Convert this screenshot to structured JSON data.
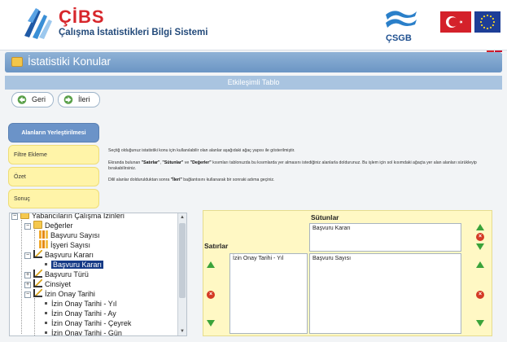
{
  "header": {
    "app_name": "ÇİBS",
    "app_subtitle": "Çalışma İstatistikleri Bilgi Sistemi",
    "ministry_abbr": "ÇSGB"
  },
  "page": {
    "title": "İstatistiki Konular",
    "subtitle": "Etkileşimli Tablo"
  },
  "nav": {
    "back_label": "Geri",
    "next_label": "İleri"
  },
  "steps": [
    {
      "label": "Alanların Yerleştirilmesi",
      "active": true
    },
    {
      "label": "Filtre Ekleme",
      "active": false
    },
    {
      "label": "Özet",
      "active": false
    },
    {
      "label": "Sonuç",
      "active": false
    }
  ],
  "instructions": {
    "p1": "Seçtiğ olduğunuz istatistiki konu için kullanılabilir olan alanlar aşağıdaki ağaç yapısı ile gösterilmiştir.",
    "p2_a": "Ekranda bulunan ",
    "p2_b1": "\"Satırlar\"",
    "p2_c": ", ",
    "p2_b2": "\"Sütunlar\"",
    "p2_d": " ve ",
    "p2_b3": "\"Değerler\"",
    "p2_e": " kısımları tablonuzda bu kısımlarda yer almasını istediğiniz alanlarla doldurunuz. Bu işlem için sol kısımdaki ağaçta yer alan alanları sürükleyip bırakabilirsiniz.",
    "p3_a": "Dilil alanlar doldurulduktan sonra ",
    "p3_b": "\"İleri\"",
    "p3_c": " bağlantısını kullanarak bir sonraki adıma geçiniz."
  },
  "tree": {
    "items": [
      {
        "label": "Yabancıların Çalışma İzinleri"
      },
      {
        "label": "Değerler"
      },
      {
        "label": "Başvuru Sayısı"
      },
      {
        "label": "İşyeri Sayısı"
      },
      {
        "label": "Başvuru Kararı"
      },
      {
        "label": "Başvuru Kararı"
      },
      {
        "label": "Başvuru Türü"
      },
      {
        "label": "Cinsiyet"
      },
      {
        "label": "İzin Onay Tarihi"
      },
      {
        "label": "İzin Onay Tarihi - Yıl"
      },
      {
        "label": "İzin Onay Tarihi - Ay"
      },
      {
        "label": "İzin Onay Tarihi - Çeyrek"
      },
      {
        "label": "İzin Onay Tarihi - Gün"
      }
    ]
  },
  "pivot": {
    "columns_label": "Sütunlar",
    "rows_label": "Satırlar",
    "columns_items": [
      "Başvuru Kararı"
    ],
    "rows_items": [
      "İzin Onay Tarihi - Yıl"
    ],
    "values_items": [
      "Başvuru Sayısı"
    ]
  },
  "colors": {
    "brand_red": "#d7262b",
    "brand_blue": "#234a7a",
    "title_bar": "#6b95c4",
    "step_active": "#6b93c8",
    "step_normal": "#fff4a8",
    "pivot_bg": "#fff8c4",
    "tree_selected": "#153a86"
  }
}
